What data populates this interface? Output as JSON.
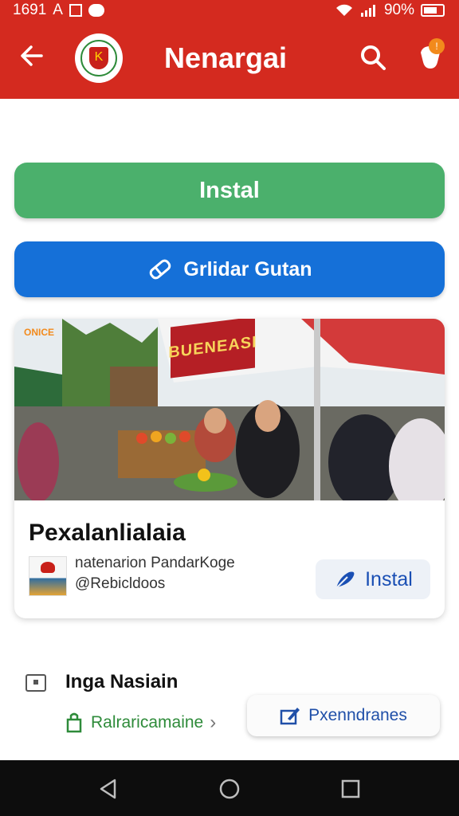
{
  "status_bar": {
    "time": "1691",
    "carrier_letter": "A",
    "battery": "90%",
    "icons": [
      "square-icon",
      "notification-dot-icon",
      "wifi-icon",
      "signal-icon",
      "battery-icon"
    ]
  },
  "app_bar": {
    "title": "Nenargai",
    "logo_letter": "K",
    "badge": "!",
    "icons": [
      "back-arrow-icon",
      "search-icon",
      "bell-icon"
    ]
  },
  "buttons": {
    "install": "Instal",
    "secondary": "Grlidar Gutan"
  },
  "card": {
    "photo_banner_text": "BUENEASI",
    "photo_tag": "ONICE",
    "title": "Pexalanlialaia",
    "subtitle_line1": "natenarion PandarKoge",
    "subtitle_line2": "@Rebicldoos",
    "install_button": "Instal"
  },
  "info": {
    "title": "Inga Nasiain",
    "link_text": "Ralraricamaine",
    "pill_button": "Pxenndranes"
  },
  "colors": {
    "app_bar": "#d42a1f",
    "install_green": "#4bb06c",
    "primary_blue": "#1570d8",
    "badge_orange": "#f28a1c",
    "nav_bar": "#0d0d0d"
  }
}
